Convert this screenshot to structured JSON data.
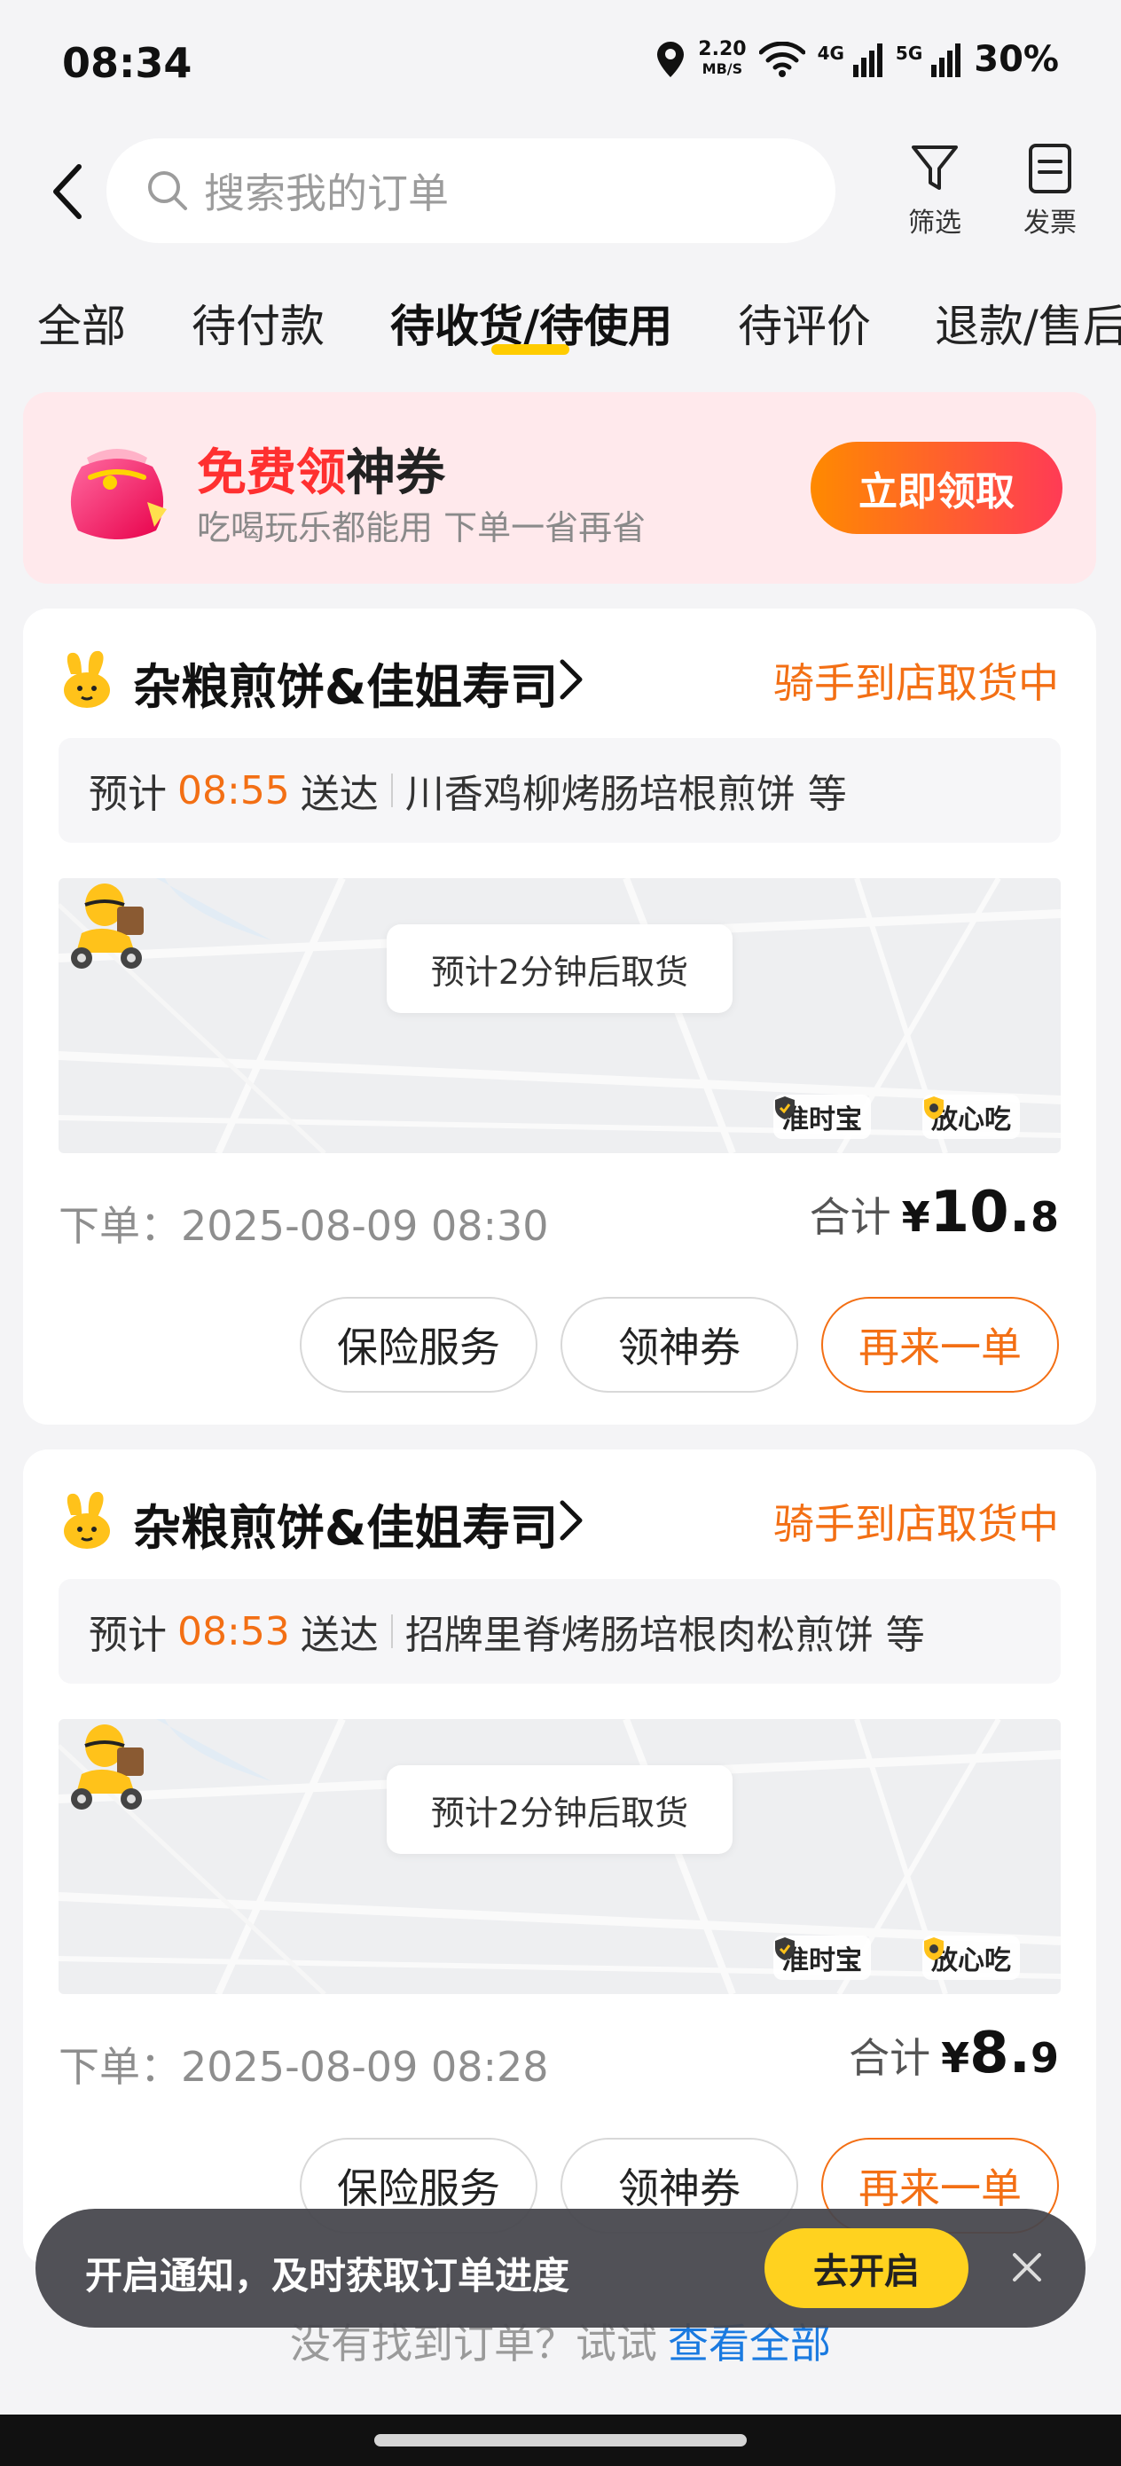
{
  "status_bar": {
    "time": "08:34",
    "speed_value": "2.20",
    "speed_unit": "MB/S",
    "net_4g": "4G",
    "net_5g": "5G",
    "battery": "30%",
    "icons": [
      "location-icon",
      "wifi-icon",
      "signal-4g-icon",
      "signal-5g-icon"
    ]
  },
  "header": {
    "search_placeholder": "搜索我的订单",
    "filter_label": "筛选",
    "invoice_label": "发票"
  },
  "tabs": [
    {
      "label": "全部",
      "active": false
    },
    {
      "label": "待付款",
      "active": false
    },
    {
      "label": "待收货/待使用",
      "active": true
    },
    {
      "label": "待评价",
      "active": false
    },
    {
      "label": "退款/售后",
      "active": false
    }
  ],
  "promo": {
    "title_highlight": "免费领",
    "title_rest": "神券",
    "subtitle": "吃喝玩乐都能用 下单一省再省",
    "button": "立即领取"
  },
  "orders": [
    {
      "store": "杂粮煎饼&佳姐寿司",
      "status": "骑手到店取货中",
      "eta_prefix": "预计",
      "eta_time": "08:55",
      "eta_suffix": "送达",
      "items": "川香鸡柳烤肠培根煎饼 等",
      "map_bubble": "预计2分钟后取货",
      "badge_1": "准时宝",
      "badge_2": "放心吃",
      "order_time": "下单：2025-08-09 08:30",
      "total_label": "合计",
      "currency": "¥",
      "total_int": "10.",
      "total_dec": "8",
      "btn_insurance": "保险服务",
      "btn_coupon": "领神券",
      "btn_reorder": "再来一单"
    },
    {
      "store": "杂粮煎饼&佳姐寿司",
      "status": "骑手到店取货中",
      "eta_prefix": "预计",
      "eta_time": "08:53",
      "eta_suffix": "送达",
      "items": "招牌里脊烤肠培根肉松煎饼 等",
      "map_bubble": "预计2分钟后取货",
      "badge_1": "准时宝",
      "badge_2": "放心吃",
      "order_time": "下单：2025-08-09 08:28",
      "total_label": "合计",
      "currency": "¥",
      "total_int": "8.",
      "total_dec": "9",
      "btn_insurance": "保险服务",
      "btn_coupon": "领神券",
      "btn_reorder": "再来一单"
    }
  ],
  "footer": {
    "not_found_text": "没有找到订单？试试",
    "not_found_link": "查看全部"
  },
  "toast": {
    "text": "开启通知，及时获取订单进度",
    "button": "去开启"
  },
  "colors": {
    "accent_orange": "#f36f14",
    "promo_red": "#ff3030",
    "tab_underline": "#ffcc00",
    "toast_button": "#ffd21f",
    "link_blue": "#1a7ae0"
  }
}
